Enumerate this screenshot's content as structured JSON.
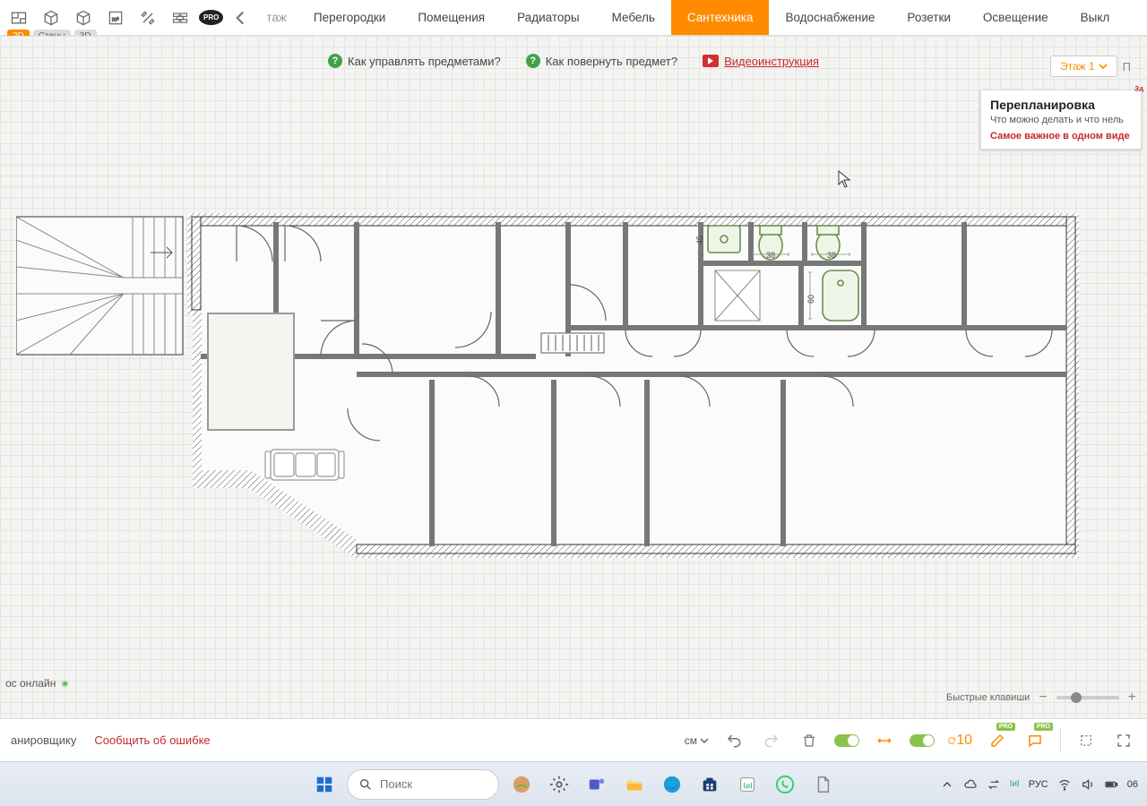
{
  "view": {
    "d2": "2D",
    "walls": "Стены",
    "d3": "3D",
    "active": "2D"
  },
  "toolbar": {
    "pro": "PRO",
    "nav_cut": "таж",
    "tabs": [
      {
        "label": "Перегородки"
      },
      {
        "label": "Помещения"
      },
      {
        "label": "Радиаторы"
      },
      {
        "label": "Мебель"
      },
      {
        "label": "Сантехника",
        "active": true
      },
      {
        "label": "Водоснабжение"
      },
      {
        "label": "Розетки"
      },
      {
        "label": "Освещение"
      },
      {
        "label": "Выкл"
      }
    ]
  },
  "help": {
    "q1": "Как управлять предметами?",
    "q2": "Как повернуть предмет?",
    "video": "Видеоинструкция"
  },
  "floor": {
    "label": "Этаж 1",
    "next": "П"
  },
  "promo": {
    "title": "Перепланировка",
    "sub": "Что можно делать и что нель",
    "cta": "Самое важное в одном виде",
    "corner": "ЗА"
  },
  "plan": {
    "dims": {
      "a": "45",
      "b": "38",
      "c": "38",
      "d": "60"
    }
  },
  "zoom": {
    "label": "Быстрые клавиши"
  },
  "status": {
    "online": "ос онлайн"
  },
  "bottombar": {
    "planner": "анировщику",
    "error": "Сообщить об ошибке",
    "unit": "см",
    "pro": "PRO"
  },
  "taskbar": {
    "search_placeholder": "Поиск",
    "lang": "РУС",
    "time_cut": "06"
  }
}
